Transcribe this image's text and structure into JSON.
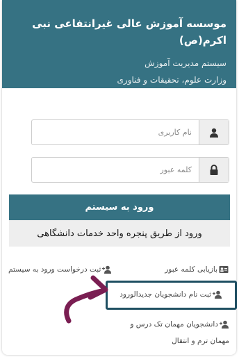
{
  "header": {
    "institution_title": "موسسه آموزش عالی غیرانتفاعی نبی اکرم(ص)",
    "system_name": "سیستم مدیریت آموزش",
    "ministry": "وزارت علوم، تحقیقات و فناوری"
  },
  "login": {
    "username_placeholder": "نام کاربری",
    "password_placeholder": "کلمه عبور",
    "submit_label": "ورود به سیستم",
    "sso_label": "ورود از طریق پنجره واحد خدمات دانشگاهی"
  },
  "links": {
    "reset_password": "بازیابی کلمه عبور",
    "request_account": "ثبت درخواست ورود به سیستم",
    "new_students": "ثبت نام دانشجویان جدیدالورود",
    "guest_students_line1": "دانشجویان مهمان تک درس و",
    "guest_students_line2": "مهمان ترم و انتقال"
  },
  "colors": {
    "brand": "#367283",
    "highlight_border": "#1f4f62",
    "annotation_arrow": "#7a1e52"
  },
  "icons": {
    "username": "user-icon",
    "password": "lock-icon",
    "reset": "id-card-icon",
    "add_user": "user-plus-icon"
  }
}
